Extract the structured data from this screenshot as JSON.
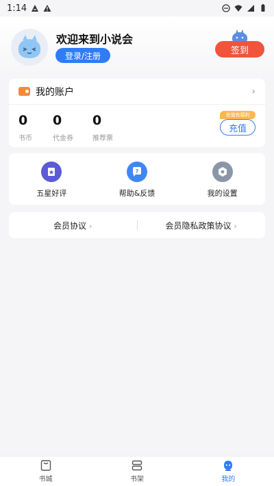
{
  "status_bar": {
    "time": "1:14"
  },
  "header": {
    "welcome": "欢迎来到小说会",
    "login_label": "登录/注册",
    "checkin_label": "签到"
  },
  "account": {
    "title": "我的账户",
    "stats": [
      {
        "value": "0",
        "label": "书币"
      },
      {
        "value": "0",
        "label": "代金券"
      },
      {
        "value": "0",
        "label": "推荐票"
      }
    ],
    "recharge_tag": "充值有福利",
    "recharge_label": "充值"
  },
  "tools": [
    {
      "label": "五星好评",
      "icon": "star-review-icon",
      "color": "#5b5bd6"
    },
    {
      "label": "帮助&反馈",
      "icon": "help-icon",
      "color": "#3f87f5"
    },
    {
      "label": "我的设置",
      "icon": "settings-icon",
      "color": "#8a96a8"
    }
  ],
  "links": [
    {
      "label": "会员协议"
    },
    {
      "label": "会员隐私政策协议"
    }
  ],
  "tabbar": [
    {
      "label": "书城",
      "icon": "bookstore-icon"
    },
    {
      "label": "书架",
      "icon": "bookshelf-icon"
    },
    {
      "label": "我的",
      "icon": "profile-icon",
      "active": true
    }
  ],
  "colors": {
    "accent": "#2f7cf6",
    "checkin": "#f0543a",
    "background": "#f5f5f7"
  }
}
